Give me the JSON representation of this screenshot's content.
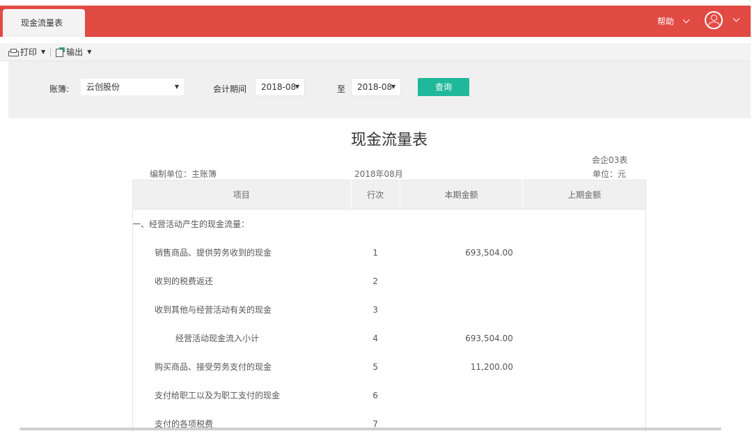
{
  "tab": {
    "label": "现金流量表"
  },
  "header": {
    "help_label": "帮助"
  },
  "toolbar": {
    "print_label": "打印",
    "export_label": "输出"
  },
  "filter": {
    "book_label": "账簿:",
    "book_value": "云创股份",
    "period_label": "会计期间",
    "period_from": "2018-08",
    "to_label": "至",
    "period_to": "2018-08",
    "query_label": "查询"
  },
  "report": {
    "title": "现金流量表",
    "form_code": "会企03表",
    "unit_org": "编制单位：主账簿",
    "period": "2018年08月",
    "currency_unit": "单位：元",
    "columns": [
      "项目",
      "行次",
      "本期金额",
      "上期金额"
    ],
    "rows": [
      {
        "item": "一、经营活动产生的现金流量：",
        "line": "",
        "current": "",
        "previous": ""
      },
      {
        "item": "销售商品、提供劳务收到的现金",
        "line": "1",
        "current": "693,504.00",
        "previous": ""
      },
      {
        "item": "收到的税费返还",
        "line": "2",
        "current": "",
        "previous": ""
      },
      {
        "item": "收到其他与经营活动有关的现金",
        "line": "3",
        "current": "",
        "previous": ""
      },
      {
        "item": "经营活动现金流入小计",
        "line": "4",
        "current": "693,504.00",
        "previous": ""
      },
      {
        "item": "购买商品、接受劳务支付的现金",
        "line": "5",
        "current": "11,200.00",
        "previous": ""
      },
      {
        "item": "支付给职工以及为职工支付的现金",
        "line": "6",
        "current": "",
        "previous": ""
      },
      {
        "item": "支付的各项税费",
        "line": "7",
        "current": "",
        "previous": ""
      }
    ]
  }
}
